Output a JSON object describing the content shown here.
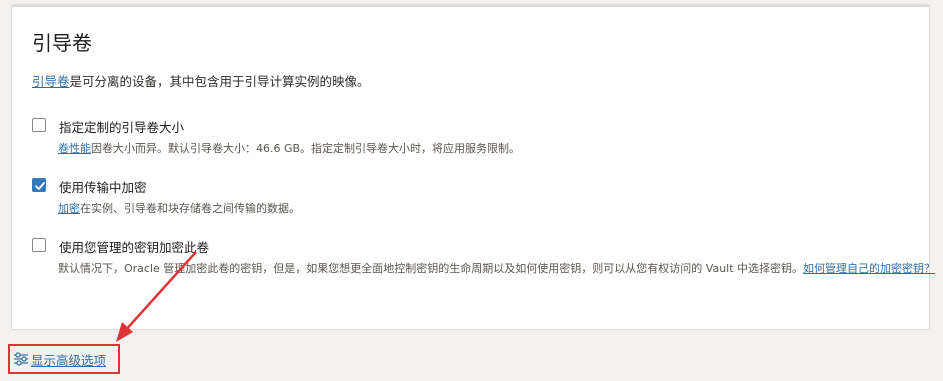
{
  "section": {
    "title": "引导卷",
    "intro_link": "引导卷",
    "intro_text": "是可分离的设备，其中包含用于引导计算实例的映像。"
  },
  "options": [
    {
      "label": "指定定制的引导卷大小",
      "checked": false,
      "help_link": "卷性能",
      "help_text": "因卷大小而异。默认引导卷大小：46.6 GB。指定定制引导卷大小时，将应用服务限制。"
    },
    {
      "label": "使用传输中加密",
      "checked": true,
      "help_link": "加密",
      "help_text": "在实例、引导卷和块存储卷之间传输的数据。"
    },
    {
      "label": "使用您管理的密钥加密此卷",
      "checked": false,
      "help_text": "默认情况下，Oracle 管理加密此卷的密钥，但是，如果您想更全面地控制密钥的生命周期以及如何使用密钥，则可以从您有权访问的 Vault 中选择密钥。",
      "help_link": "如何管理自己的加密密钥？"
    }
  ],
  "advanced": {
    "label": "显示高级选项",
    "icon": "sliders-icon"
  },
  "colors": {
    "link": "#2d6ea8",
    "checkbox_checked": "#3178bd",
    "annotation": "#e03434"
  }
}
